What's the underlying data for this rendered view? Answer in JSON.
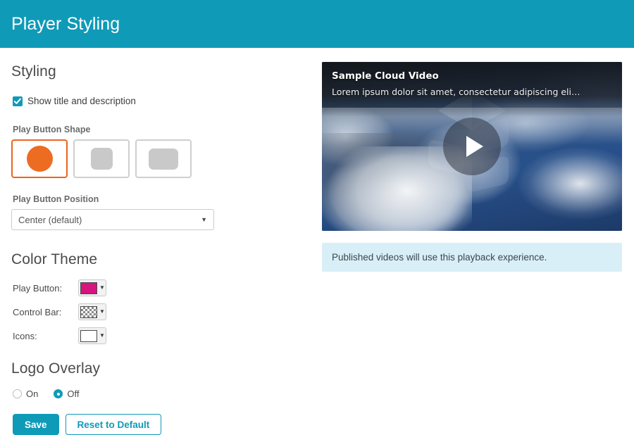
{
  "header": {
    "title": "Player Styling",
    "bg_color": "#0f9ab8"
  },
  "styling": {
    "heading": "Styling",
    "show_title_checkbox": {
      "label": "Show title and description",
      "checked": true,
      "icon": "check-icon"
    },
    "play_button_shape": {
      "label": "Play Button Shape",
      "options": [
        {
          "name": "circle",
          "selected": true,
          "color": "#ec6c22"
        },
        {
          "name": "rounded-square",
          "selected": false,
          "color": "#c9c9c9"
        },
        {
          "name": "rounded-rectangle",
          "selected": false,
          "color": "#c9c9c9"
        }
      ],
      "selected_border_color": "#e8661f"
    },
    "play_button_position": {
      "label": "Play Button Position",
      "value": "Center (default)",
      "caret_icon": "chevron-down-icon"
    }
  },
  "color_theme": {
    "heading": "Color Theme",
    "rows": [
      {
        "label": "Play Button:",
        "color": "#d6137f",
        "transparent": false
      },
      {
        "label": "Control Bar:",
        "color": "transparent",
        "transparent": true
      },
      {
        "label": "Icons:",
        "color": "#ffffff",
        "transparent": false
      }
    ],
    "caret_icon": "chevron-down-icon"
  },
  "logo_overlay": {
    "heading": "Logo Overlay",
    "options": [
      {
        "label": "On",
        "selected": false
      },
      {
        "label": "Off",
        "selected": true
      }
    ]
  },
  "actions": {
    "save_label": "Save",
    "reset_label": "Reset to Default",
    "primary_color": "#0f9ab8"
  },
  "preview": {
    "video_title": "Sample Cloud Video",
    "video_description": "Lorem ipsum dolor sit amet, consectetur adipiscing eli…",
    "play_icon": "play-icon",
    "watermark_icon": "hexagon-logo-icon",
    "notice": "Published videos will use this playback experience.",
    "notice_bg": "#d9eff7"
  }
}
